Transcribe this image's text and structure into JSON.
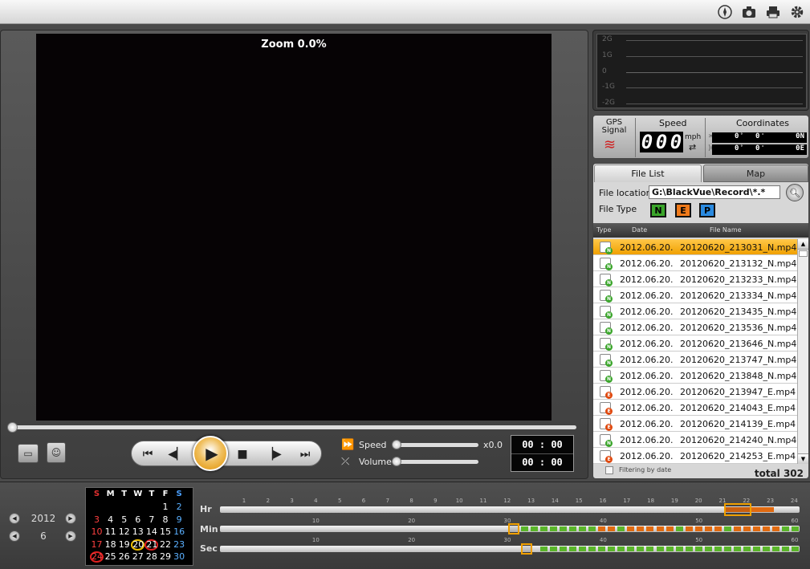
{
  "toolbar": {
    "icons": [
      "compass-icon",
      "camera-icon",
      "printer-icon",
      "gear-icon"
    ]
  },
  "player": {
    "zoom_label": "Zoom 0.0%",
    "speed_label": "Speed",
    "speed_value": "x0.0",
    "volume_label": "Volume",
    "time_current": "00 : 00",
    "time_total": "00 : 00"
  },
  "gsensor": {
    "labels": [
      "2G",
      "1G",
      "0",
      "-1G",
      "-2G"
    ]
  },
  "gps": {
    "signal_label": "GPS Signal",
    "speed_label": "Speed",
    "speed_digits": [
      "0",
      "0",
      "0"
    ],
    "speed_unit": "mph",
    "coordinates_label": "Coordinates",
    "lat": {
      "deg": "0",
      "min": "0",
      "dir": "0N"
    },
    "lon": {
      "deg": "0",
      "min": "0",
      "dir": "0E"
    }
  },
  "files": {
    "tab_list": "File List",
    "tab_map": "Map",
    "location_label": "File location",
    "location_value": "G:\\BlackVue\\Record\\*.*",
    "type_label": "File Type",
    "types": [
      {
        "letter": "N",
        "color": "#3aa52a"
      },
      {
        "letter": "E",
        "color": "#f07a1a"
      },
      {
        "letter": "P",
        "color": "#2a8ae0"
      }
    ],
    "columns": {
      "type": "Type",
      "date": "Date",
      "name": "File Name"
    },
    "rows": [
      {
        "type": "N",
        "date": "2012.06.20.",
        "name": "20120620_213031_N.mp4"
      },
      {
        "type": "N",
        "date": "2012.06.20.",
        "name": "20120620_213132_N.mp4"
      },
      {
        "type": "N",
        "date": "2012.06.20.",
        "name": "20120620_213233_N.mp4"
      },
      {
        "type": "N",
        "date": "2012.06.20.",
        "name": "20120620_213334_N.mp4"
      },
      {
        "type": "N",
        "date": "2012.06.20.",
        "name": "20120620_213435_N.mp4"
      },
      {
        "type": "N",
        "date": "2012.06.20.",
        "name": "20120620_213536_N.mp4"
      },
      {
        "type": "N",
        "date": "2012.06.20.",
        "name": "20120620_213646_N.mp4"
      },
      {
        "type": "N",
        "date": "2012.06.20.",
        "name": "20120620_213747_N.mp4"
      },
      {
        "type": "N",
        "date": "2012.06.20.",
        "name": "20120620_213848_N.mp4"
      },
      {
        "type": "E",
        "date": "2012.06.20.",
        "name": "20120620_213947_E.mp4"
      },
      {
        "type": "E",
        "date": "2012.06.20.",
        "name": "20120620_214043_E.mp4"
      },
      {
        "type": "E",
        "date": "2012.06.20.",
        "name": "20120620_214139_E.mp4"
      },
      {
        "type": "N",
        "date": "2012.06.20.",
        "name": "20120620_214240_N.mp4"
      },
      {
        "type": "E",
        "date": "2012.06.20.",
        "name": "20120620_214253_E.mp4"
      }
    ],
    "selected_index": 0,
    "filter_label": "Filtering by date",
    "total_label": "total 302"
  },
  "calendar": {
    "year": "2012",
    "month": "6",
    "weekdays": [
      "S",
      "M",
      "T",
      "W",
      "T",
      "F",
      "S"
    ],
    "weeks": [
      [
        "",
        "",
        "",
        "",
        "",
        "1",
        "2"
      ],
      [
        "3",
        "4",
        "5",
        "6",
        "7",
        "8",
        "9"
      ],
      [
        "10",
        "11",
        "12",
        "13",
        "14",
        "15",
        "16"
      ],
      [
        "17",
        "18",
        "19",
        "20",
        "21",
        "22",
        "23"
      ],
      [
        "24",
        "25",
        "26",
        "27",
        "28",
        "29",
        "30"
      ]
    ],
    "today": "20",
    "circled": [
      "21",
      "24"
    ]
  },
  "timeline": {
    "hr_label": "Hr",
    "min_label": "Min",
    "sec_label": "Sec",
    "hr_ticks": [
      "1",
      "2",
      "3",
      "4",
      "5",
      "6",
      "7",
      "8",
      "9",
      "10",
      "11",
      "12",
      "13",
      "14",
      "15",
      "16",
      "17",
      "18",
      "19",
      "20",
      "21",
      "22",
      "23",
      "24"
    ],
    "min_ticks": [
      "10",
      "20",
      "30",
      "40",
      "50",
      "60"
    ],
    "sec_ticks": [
      "10",
      "20",
      "30",
      "40",
      "50",
      "60"
    ],
    "colors": {
      "normal": "#5ab52a",
      "event": "#e06a10",
      "marker": "#f0a000"
    }
  }
}
